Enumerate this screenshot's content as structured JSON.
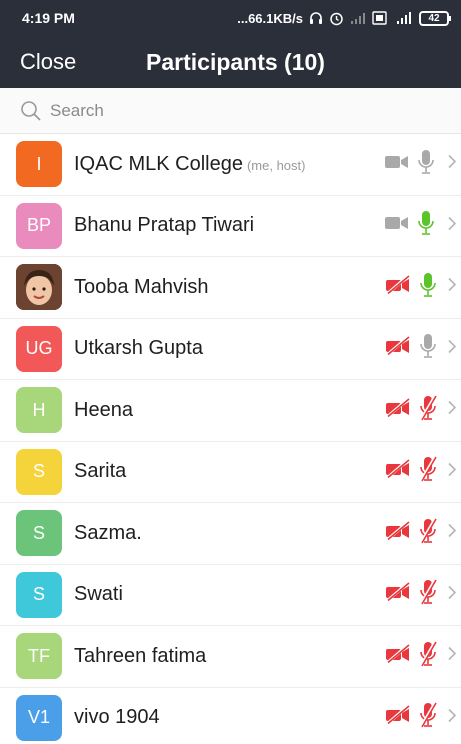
{
  "status_bar": {
    "time": "4:19 PM",
    "net_speed": "...66.1KB/s",
    "battery": "42",
    "icons": [
      "headphones-icon",
      "alarm-icon",
      "signal-icon",
      "data-icon",
      "signal-4g-icon"
    ]
  },
  "nav": {
    "close_label": "Close",
    "title": "Participants (10)"
  },
  "search": {
    "placeholder": "Search",
    "value": ""
  },
  "colors": {
    "header_bg": "#2b2f3a",
    "mic_on": "#5cc42b",
    "muted_red": "#e8383d",
    "icon_grey": "#a9a9a9"
  },
  "participants": [
    {
      "initials": "I",
      "name": "IQAC MLK College",
      "tag": "(me, host)",
      "color": "#f26a22",
      "video": "on",
      "mic": "idle"
    },
    {
      "initials": "BP",
      "name": "Bhanu Pratap Tiwari",
      "tag": "",
      "color": "#ea8bbd",
      "video": "on",
      "mic": "active"
    },
    {
      "initials": "",
      "name": "Tooba Mahvish",
      "tag": "",
      "color": "#8a5a3c",
      "photo": true,
      "video": "off",
      "mic": "active"
    },
    {
      "initials": "UG",
      "name": "Utkarsh Gupta",
      "tag": "",
      "color": "#f25858",
      "video": "off",
      "mic": "idle"
    },
    {
      "initials": "H",
      "name": "Heena",
      "tag": "",
      "color": "#a8d67a",
      "video": "off",
      "mic": "muted"
    },
    {
      "initials": "S",
      "name": "Sarita",
      "tag": "",
      "color": "#f5d33a",
      "video": "off",
      "mic": "muted"
    },
    {
      "initials": "S",
      "name": "Sazma.",
      "tag": "",
      "color": "#6bc47a",
      "video": "off",
      "mic": "muted"
    },
    {
      "initials": "S",
      "name": "Swati",
      "tag": "",
      "color": "#3fc8d9",
      "video": "off",
      "mic": "muted"
    },
    {
      "initials": "TF",
      "name": "Tahreen fatima",
      "tag": "",
      "color": "#a8d67a",
      "video": "off",
      "mic": "muted"
    },
    {
      "initials": "V1",
      "name": "vivo 1904",
      "tag": "",
      "color": "#4a9fe8",
      "video": "off",
      "mic": "muted"
    }
  ]
}
